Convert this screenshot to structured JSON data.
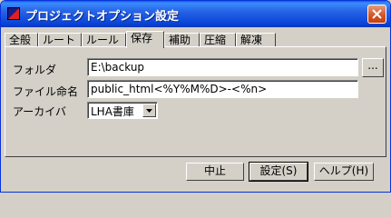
{
  "window": {
    "title": "プロジェクトオプション設定"
  },
  "tabs": [
    {
      "label": "全般"
    },
    {
      "label": "ルート"
    },
    {
      "label": "ルール"
    },
    {
      "label": "保存",
      "active": true
    },
    {
      "label": "補助"
    },
    {
      "label": "圧縮"
    },
    {
      "label": "解凍"
    }
  ],
  "form": {
    "folder": {
      "label": "フォルダ",
      "value": "E:\\backup"
    },
    "filename": {
      "label": "ファイル命名",
      "value": "public_html<%Y%M%D>-<%n>"
    },
    "archiver": {
      "label": "アーカイバ",
      "value": "LHA書庫"
    },
    "browse_label": "..."
  },
  "buttons": {
    "cancel": "中止",
    "ok": "設定(S)",
    "help": "ヘルプ(H)"
  },
  "colors": {
    "titlebar": "#0842d6",
    "face": "#d4d0c8",
    "close": "#d2582b"
  }
}
